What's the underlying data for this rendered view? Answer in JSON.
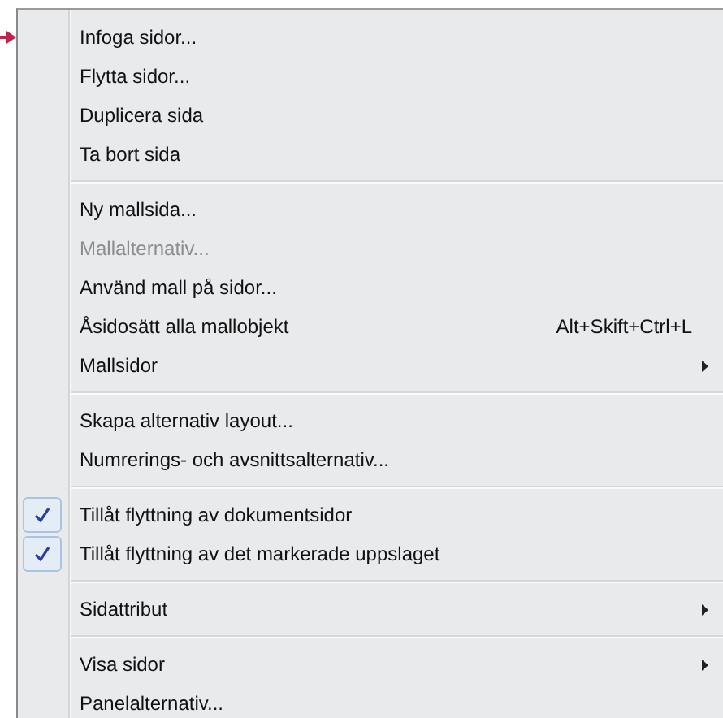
{
  "menu": {
    "groups": [
      {
        "items": [
          {
            "label": "Infoga sidor..."
          },
          {
            "label": "Flytta sidor..."
          },
          {
            "label": "Duplicera sida"
          },
          {
            "label": "Ta bort sida"
          }
        ]
      },
      {
        "items": [
          {
            "label": "Ny mallsida..."
          },
          {
            "label": "Mallalternativ...",
            "disabled": true
          },
          {
            "label": "Använd mall på sidor..."
          },
          {
            "label": "Åsidosätt alla mallobjekt",
            "shortcut": "Alt+Skift+Ctrl+L"
          },
          {
            "label": "Mallsidor",
            "submenu": true
          }
        ]
      },
      {
        "items": [
          {
            "label": "Skapa alternativ layout..."
          },
          {
            "label": "Numrerings- och avsnittsalternativ..."
          }
        ]
      },
      {
        "items": [
          {
            "label": "Tillåt flyttning av dokumentsidor",
            "checked": true
          },
          {
            "label": "Tillåt flyttning av det markerade uppslaget",
            "checked": true
          }
        ]
      },
      {
        "items": [
          {
            "label": "Sidattribut",
            "submenu": true
          }
        ]
      },
      {
        "items": [
          {
            "label": "Visa sidor",
            "submenu": true
          },
          {
            "label": "Panelalternativ..."
          }
        ]
      }
    ]
  }
}
